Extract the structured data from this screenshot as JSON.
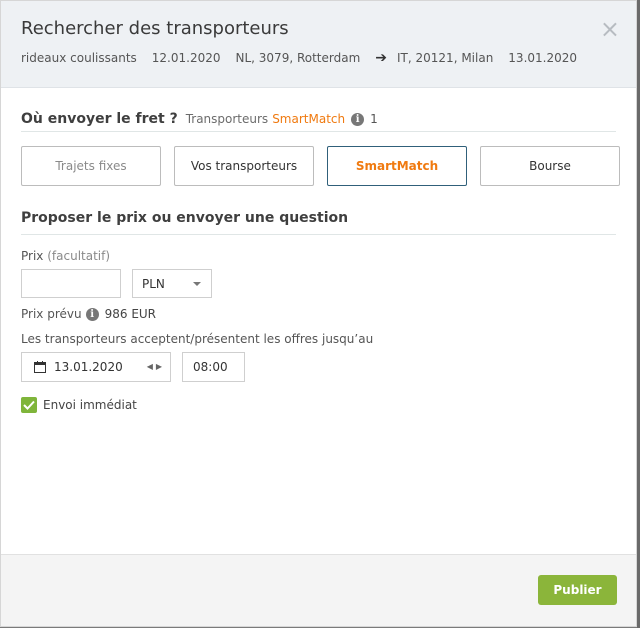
{
  "header": {
    "title": "Rechercher des transporteurs",
    "cargo_type": "rideaux coulissants",
    "load_date": "12.01.2020",
    "origin": "NL, 3079, Rotterdam",
    "destination": "IT, 20121, Milan",
    "unload_date": "13.01.2020"
  },
  "recipients": {
    "heading": "Où envoyer le fret ?",
    "carriers_label": "Transporteurs",
    "smartmatch_label": "SmartMatch",
    "count": "1"
  },
  "tabs": [
    {
      "label": "Trajets fixes",
      "state": "disabled"
    },
    {
      "label": "Vos transporteurs",
      "state": "normal"
    },
    {
      "label": "SmartMatch",
      "state": "active"
    },
    {
      "label": "Bourse",
      "state": "normal"
    }
  ],
  "offer": {
    "heading": "Proposer le prix ou envoyer une question",
    "price_label": "Prix",
    "price_optional": "(facultatif)",
    "price_value": "",
    "currency": "PLN",
    "expected_label": "Prix prévu",
    "expected_value": "986 EUR",
    "deadline_label": "Les transporteurs acceptent/présentent les offres jusqu’au",
    "deadline_date": "13.01.2020",
    "deadline_time": "08:00",
    "immediate_label": "Envoi immédiat",
    "immediate_checked": true
  },
  "footer": {
    "publish_label": "Publier"
  },
  "colors": {
    "accent_orange": "#f07a10",
    "primary_green": "#8bb53a",
    "active_border": "#30607a"
  }
}
